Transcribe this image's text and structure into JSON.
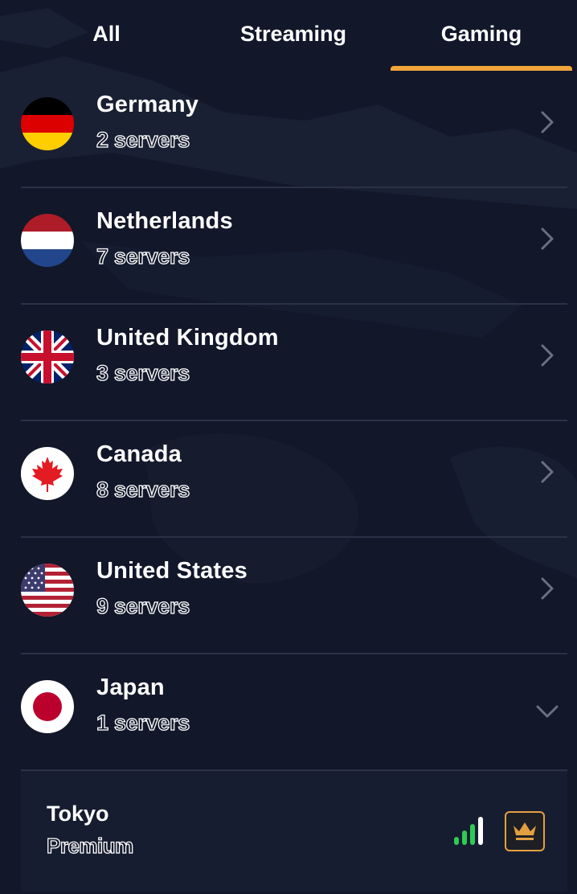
{
  "tabs": {
    "all": "All",
    "streaming": "Streaming",
    "gaming": "Gaming",
    "active": "Gaming"
  },
  "accent_color": "#f0a53a",
  "countries": [
    {
      "name": "Germany",
      "servers": "2 servers",
      "flag": "germany-flag-icon",
      "state": "collapsed"
    },
    {
      "name": "Netherlands",
      "servers": "7 servers",
      "flag": "netherlands-flag-icon",
      "state": "collapsed"
    },
    {
      "name": "United Kingdom",
      "servers": "3 servers",
      "flag": "united-kingdom-flag-icon",
      "state": "collapsed"
    },
    {
      "name": "Canada",
      "servers": "8 servers",
      "flag": "canada-flag-icon",
      "state": "collapsed"
    },
    {
      "name": "United States",
      "servers": "9 servers",
      "flag": "united-states-flag-icon",
      "state": "collapsed"
    },
    {
      "name": "Japan",
      "servers": "1 servers",
      "flag": "japan-flag-icon",
      "state": "expanded"
    }
  ],
  "expanded_server": {
    "city": "Tokyo",
    "tier": "Premium",
    "signal_icon": "signal-strength-icon",
    "signal_color": "#2ecc55",
    "premium_icon": "crown-icon",
    "premium_color": "#e3a040"
  }
}
